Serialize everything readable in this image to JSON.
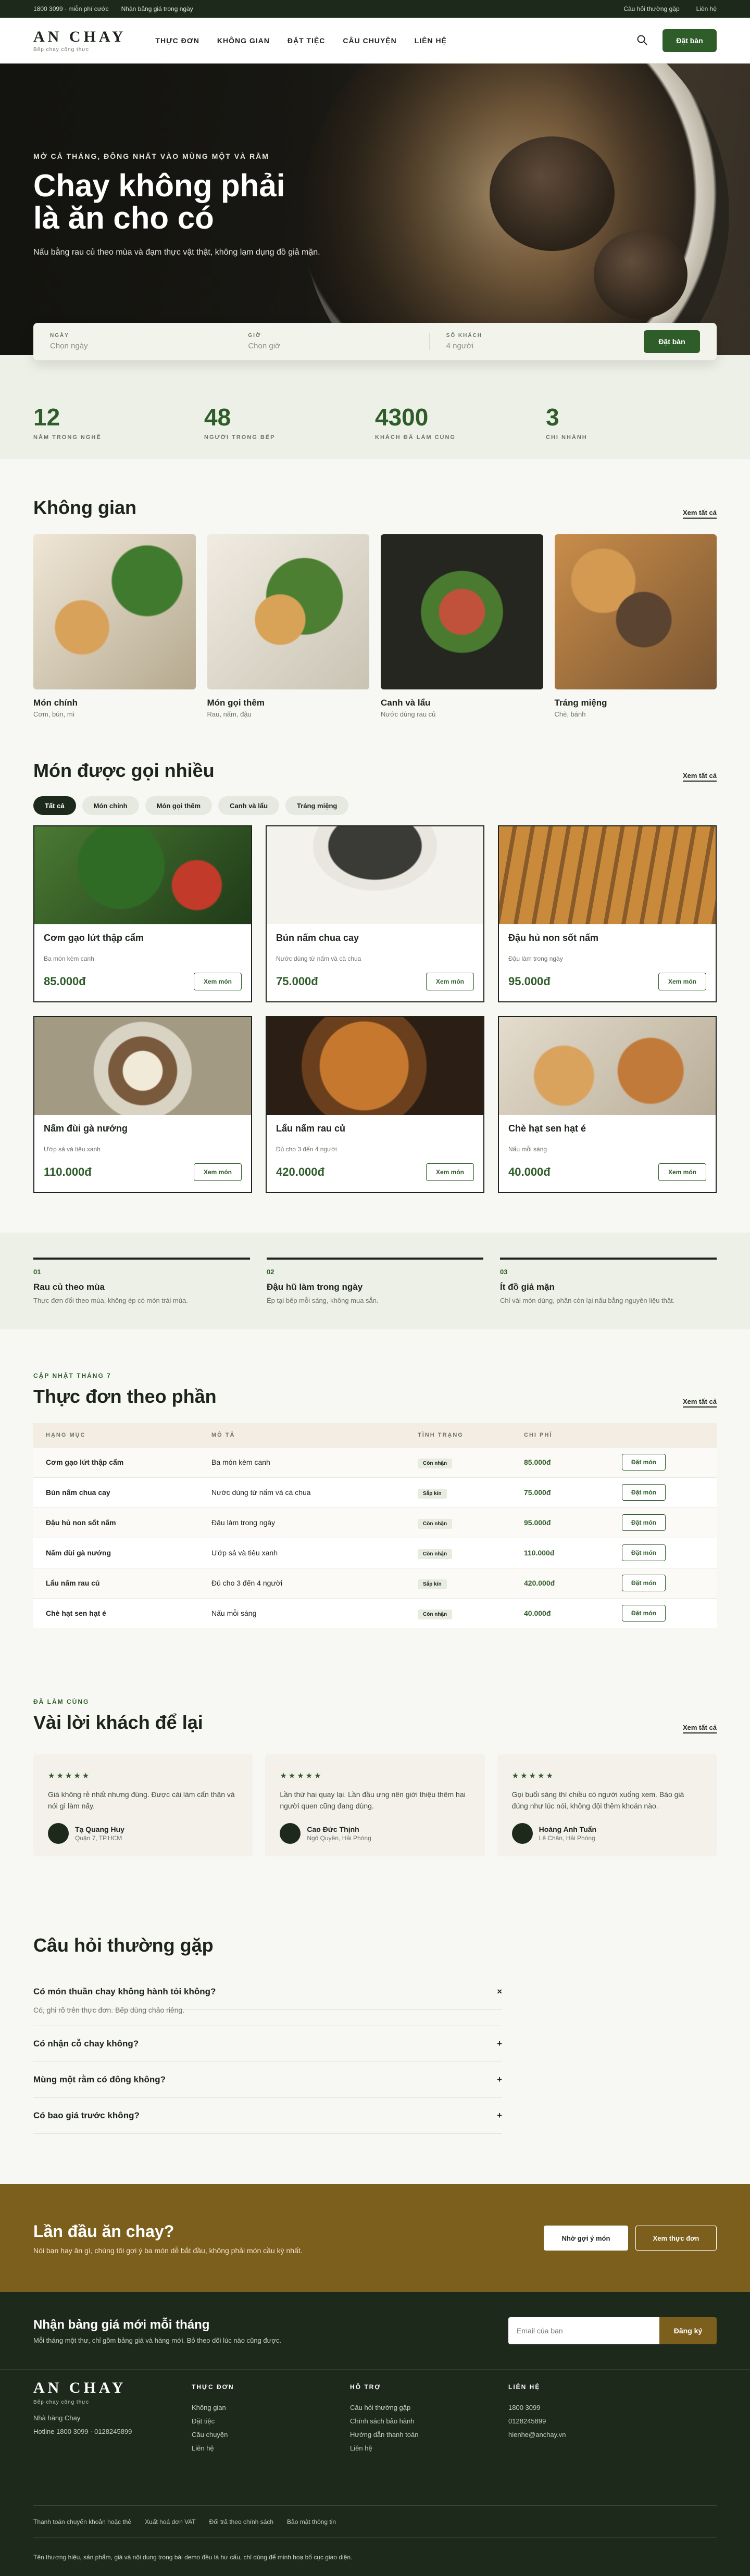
{
  "topbar": {
    "phone": "1800 3099 · miễn phí cước",
    "notice": "Nhận bảng giá trong ngày",
    "faq": "Câu hỏi thường gặp",
    "contact": "Liên hệ"
  },
  "nav": {
    "logo": "AN CHAY",
    "logo_sub": "Bếp chay công thực",
    "menu": [
      "THỰC ĐƠN",
      "KHÔNG GIAN",
      "ĐẶT TIỆC",
      "CÂU CHUYỆN",
      "LIÊN HỆ"
    ],
    "cta": "Đặt bàn"
  },
  "hero": {
    "eyebrow": "MỞ CẢ THÁNG, ĐÔNG NHẤT VÀO MÙNG MỘT VÀ RẰM",
    "title": "Chay không phải là ăn cho có",
    "subtitle": "Nấu bằng rau củ theo mùa và đạm thực vật thật, không lạm dụng đồ giả mặn."
  },
  "booking": {
    "fields": [
      {
        "label": "NGÀY",
        "value": "Chọn ngày"
      },
      {
        "label": "GIỜ",
        "value": "Chọn giờ"
      },
      {
        "label": "SỐ KHÁCH",
        "value": "4 người"
      }
    ],
    "button": "Đặt bàn"
  },
  "stats": [
    {
      "value": "12",
      "label": "NĂM TRONG NGHỀ"
    },
    {
      "value": "48",
      "label": "NGƯỜI TRONG BẾP"
    },
    {
      "value": "4300",
      "label": "KHÁCH ĐÃ LÀM CÙNG"
    },
    {
      "value": "3",
      "label": "CHI NHÁNH"
    }
  ],
  "space": {
    "title": "Không gian",
    "link": "Xem tất cả",
    "items": [
      {
        "title": "Món chính",
        "sub": "Cơm, bún, mì"
      },
      {
        "title": "Món gọi thêm",
        "sub": "Rau, nấm, đậu"
      },
      {
        "title": "Canh và lẩu",
        "sub": "Nước dùng rau củ"
      },
      {
        "title": "Tráng miệng",
        "sub": "Chè, bánh"
      }
    ]
  },
  "popular": {
    "title": "Món được gọi nhiều",
    "link": "Xem tất cả",
    "tabs": [
      "Tất cả",
      "Món chính",
      "Món gọi thêm",
      "Canh và lẩu",
      "Tráng miệng"
    ],
    "btn": "Xem món",
    "items": [
      {
        "name": "Cơm gạo lứt thập cẩm",
        "desc": "Ba món kèm canh",
        "price": "85.000đ"
      },
      {
        "name": "Bún nấm chua cay",
        "desc": "Nước dùng từ nấm và cà chua",
        "price": "75.000đ"
      },
      {
        "name": "Đậu hủ non sốt nấm",
        "desc": "Đậu làm trong ngày",
        "price": "95.000đ"
      },
      {
        "name": "Nấm đùi gà nướng",
        "desc": "Ướp sả và tiêu xanh",
        "price": "110.000đ"
      },
      {
        "name": "Lẩu nấm rau củ",
        "desc": "Đủ cho 3 đến 4 người",
        "price": "420.000đ"
      },
      {
        "name": "Chè hạt sen hạt é",
        "desc": "Nấu mỗi sáng",
        "price": "40.000đ"
      }
    ]
  },
  "features": [
    {
      "num": "01",
      "title": "Rau củ theo mùa",
      "desc": "Thực đơn đổi theo mùa, không ép có món trái mùa."
    },
    {
      "num": "02",
      "title": "Đậu hũ làm trong ngày",
      "desc": "Ép tại bếp mỗi sáng, không mua sẵn."
    },
    {
      "num": "03",
      "title": "Ít đồ giả mặn",
      "desc": "Chỉ vài món dùng, phần còn lại nấu bằng nguyên liệu thật."
    }
  ],
  "menu_table": {
    "kicker": "CẬP NHẬT THÁNG 7",
    "title": "Thực đơn theo phần",
    "link": "Xem tất cả",
    "headers": [
      "HẠNG MỤC",
      "MÔ TẢ",
      "TÌNH TRẠNG",
      "CHI PHÍ",
      ""
    ],
    "btn": "Đặt món",
    "rows": [
      {
        "name": "Cơm gạo lứt thập cẩm",
        "desc": "Ba món kèm canh",
        "status": "Còn nhận",
        "price": "85.000đ"
      },
      {
        "name": "Bún nấm chua cay",
        "desc": "Nước dùng từ nấm và cà chua",
        "status": "Sắp kín",
        "price": "75.000đ"
      },
      {
        "name": "Đậu hủ non sốt nấm",
        "desc": "Đậu làm trong ngày",
        "status": "Còn nhận",
        "price": "95.000đ"
      },
      {
        "name": "Nấm đùi gà nướng",
        "desc": "Ướp sả và tiêu xanh",
        "status": "Còn nhận",
        "price": "110.000đ"
      },
      {
        "name": "Lẩu nấm rau củ",
        "desc": "Đủ cho 3 đến 4 người",
        "status": "Sắp kín",
        "price": "420.000đ"
      },
      {
        "name": "Chè hạt sen hạt é",
        "desc": "Nấu mỗi sáng",
        "status": "Còn nhận",
        "price": "40.000đ"
      }
    ]
  },
  "reviews": {
    "kicker": "ĐÃ LÀM CÙNG",
    "title": "Vài lời khách để lại",
    "link": "Xem tất cả",
    "stars": "★★★★★",
    "items": [
      {
        "quote": "Giá không rẻ nhất nhưng đúng. Được cái làm cẩn thận và nói gì làm nấy.",
        "name": "Tạ Quang Huy",
        "place": "Quận 7, TP.HCM"
      },
      {
        "quote": "Lần thứ hai quay lại. Lần đầu ưng nên giới thiệu thêm hai người quen cũng đang dùng.",
        "name": "Cao Đức Thịnh",
        "place": "Ngô Quyền, Hải Phòng"
      },
      {
        "quote": "Gọi buổi sáng thì chiều có người xuống xem. Báo giá đúng như lúc nói, không đội thêm khoản nào.",
        "name": "Hoàng Anh Tuấn",
        "place": "Lê Chân, Hải Phòng"
      }
    ]
  },
  "faq": {
    "title": "Câu hỏi thường gặp",
    "items": [
      {
        "q": "Có món thuần chay không hành tỏi không?",
        "a": "Có, ghi rõ trên thực đơn. Bếp dùng chảo riêng.",
        "icon": "×"
      },
      {
        "q": "Có nhận cỗ chay không?",
        "icon": "+"
      },
      {
        "q": "Mùng một rằm có đông không?",
        "icon": "+"
      },
      {
        "q": "Có bao giá trước không?",
        "icon": "+"
      }
    ]
  },
  "cta": {
    "title": "Lần đầu ăn chay?",
    "sub": "Nói bạn hay ăn gì, chúng tôi gợi ý ba món dễ bắt đầu, không phải món cầu kỳ nhất.",
    "btn1": "Nhờ gợi ý món",
    "btn2": "Xem thực đơn"
  },
  "newsletter": {
    "title": "Nhận bảng giá mới mỗi tháng",
    "sub": "Mỗi tháng một thư, chỉ gồm bảng giá và hàng mới. Bỏ theo dõi lúc nào cũng được.",
    "placeholder": "Email của bạn",
    "btn": "Đăng ký"
  },
  "footer": {
    "logo": "AN CHAY",
    "logo_sub": "Bếp chay công thực",
    "line1": "Nhà hàng Chay",
    "line2": "Hotline 1800 3099 · 0128245899",
    "cols": [
      {
        "h": "THỰC ĐƠN",
        "items": [
          "Không gian",
          "Đặt tiệc",
          "Câu chuyện",
          "Liên hệ"
        ]
      },
      {
        "h": "HỖ TRỢ",
        "items": [
          "Câu hỏi thường gặp",
          "Chính sách bảo hành",
          "Hướng dẫn thanh toán",
          "Liên hệ"
        ]
      },
      {
        "h": "LIÊN HỆ",
        "items": [
          "1800 3099",
          "0128245899",
          "hienhe@anchay.vn"
        ]
      }
    ],
    "links": [
      "Thanh toán chuyển khoản hoặc thẻ",
      "Xuất hoá đơn VAT",
      "Đổi trả theo chính sách",
      "Bảo mật thông tin"
    ],
    "copy": "Tên thương hiệu, sản phẩm, giá và nội dung trong bài demo đều là hư cấu, chỉ dùng để minh hoạ bố cục giao diện."
  }
}
